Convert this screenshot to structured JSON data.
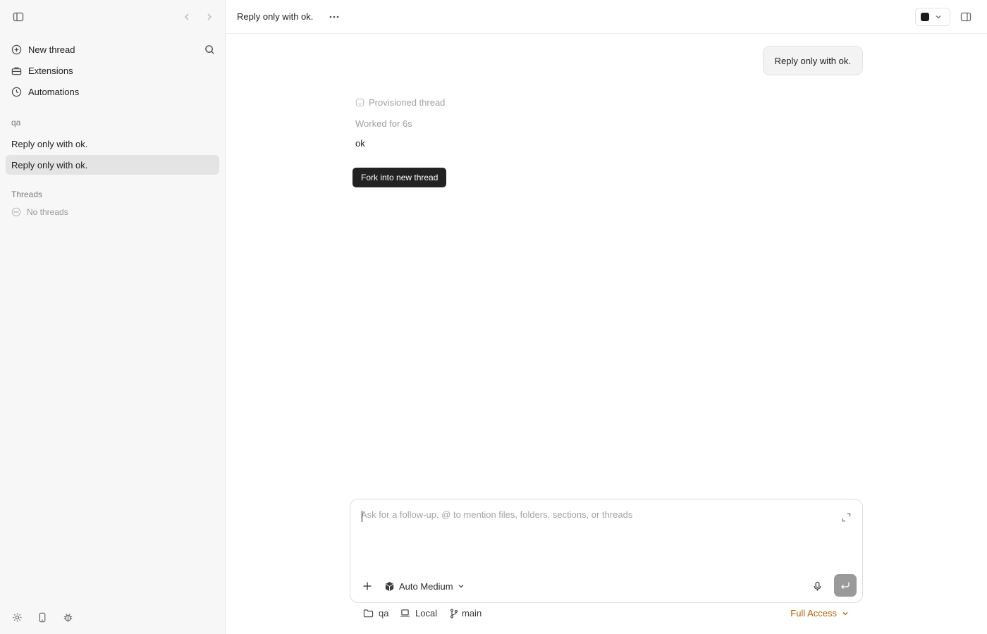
{
  "sidebar": {
    "nav": [
      {
        "label": "New thread"
      },
      {
        "label": "Extensions"
      },
      {
        "label": "Automations"
      }
    ],
    "project": {
      "name": "qa",
      "threads": [
        {
          "title": "Reply only with ok.",
          "active": false
        },
        {
          "title": "Reply only with ok.",
          "active": true
        }
      ]
    },
    "threads_section": {
      "label": "Threads",
      "empty_text": "No threads"
    }
  },
  "header": {
    "title": "Reply only with ok.",
    "more_label": "···"
  },
  "conversation": {
    "user_message": "Reply only with ok.",
    "status": "Provisioned thread",
    "worked": "Worked for 6s",
    "answer": "ok",
    "tooltip": "Fork into new thread"
  },
  "composer": {
    "placeholder": "Ask for a follow-up. @ to mention files, folders, sections, or threads",
    "model": "Auto Medium"
  },
  "footer": {
    "folder": "qa",
    "environment": "Local",
    "branch": "main",
    "access": "Full Access"
  },
  "colors": {
    "accent_access": "#b35f00",
    "active_row": "#e4e4e4",
    "tooltip_bg": "#222222"
  }
}
